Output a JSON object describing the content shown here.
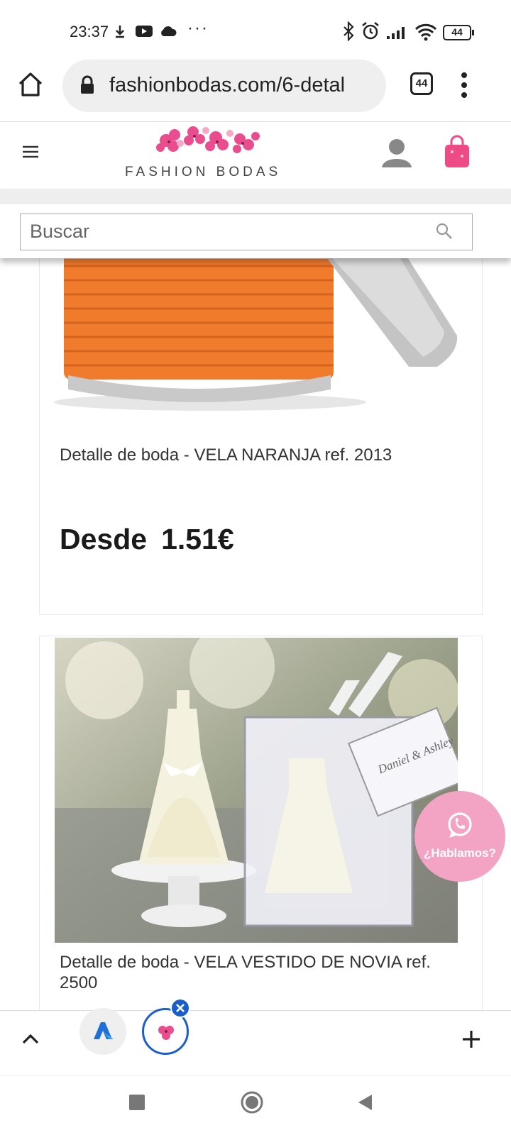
{
  "status_bar": {
    "time": "23:37",
    "battery": "44",
    "icons": [
      "download-icon",
      "youtube-icon",
      "cloud-icon",
      "more-dots-icon",
      "bluetooth-icon",
      "alarm-icon",
      "signal-icon",
      "wifi-icon",
      "battery-icon"
    ]
  },
  "browser": {
    "url": "fashionbodas.com/6-detal",
    "tab_count": "44",
    "icons": [
      "home-icon",
      "lock-icon",
      "tabs-icon",
      "menu-dots-icon"
    ]
  },
  "site_header": {
    "brand": "FASHION BODAS",
    "icons": [
      "hamburger-icon",
      "user-icon",
      "shopping-bag-icon"
    ],
    "colors": {
      "brand_pink": "#e94d8d",
      "bag_pink": "#ee4a85"
    }
  },
  "search": {
    "placeholder": "Buscar"
  },
  "products": [
    {
      "title": "Detalle de boda - VELA NARANJA ref. 2013",
      "price_prefix": "Desde",
      "price": "1.51€"
    },
    {
      "title": "Detalle de boda - VELA VESTIDO DE NOVIA ref. 2500",
      "box_tag_text": "Daniel & Ashley"
    }
  ],
  "whatsapp": {
    "label": "¿Hablamos?",
    "color": "#f3a3c3"
  },
  "tab_bar": {
    "icons": [
      "chevron-up-icon",
      "tab-app-icon",
      "tab-fashionbodas-icon",
      "close-badge-icon",
      "plus-icon"
    ]
  },
  "nav_bar": {
    "icons": [
      "recent-apps-icon",
      "home-circle-icon",
      "back-icon"
    ]
  }
}
